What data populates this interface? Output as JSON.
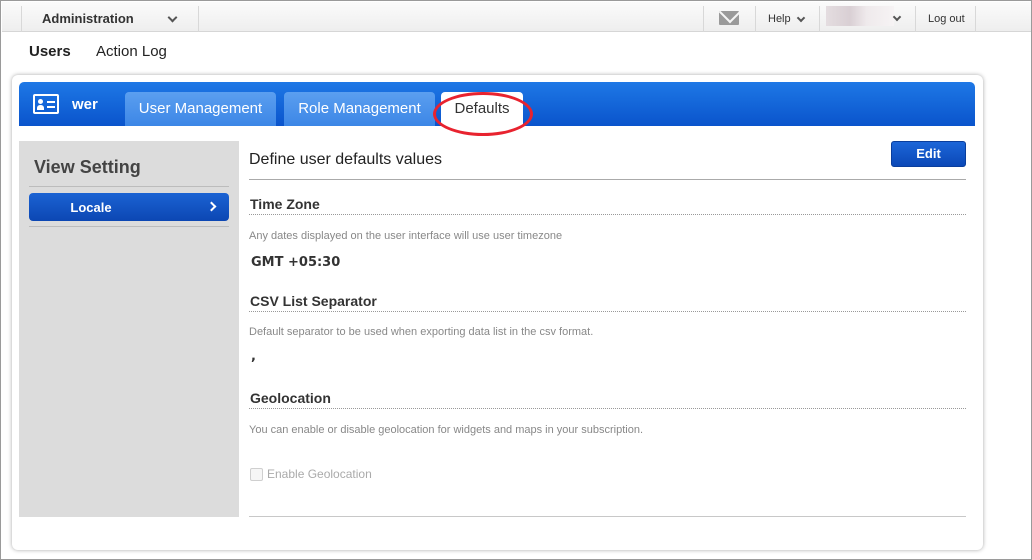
{
  "topbar": {
    "module_label": "Administration",
    "mail_icon": "envelope-icon",
    "help_label": "Help",
    "logout_label": "Log out"
  },
  "subnav": {
    "users_label": "Users",
    "action_log_label": "Action Log"
  },
  "header": {
    "icon": "id-card-icon",
    "title": "wer",
    "tabs": [
      {
        "label": "User Management",
        "active": false
      },
      {
        "label": "Role Management",
        "active": false
      },
      {
        "label": "Defaults",
        "active": true
      }
    ],
    "highlight_color": "#e8232f"
  },
  "sidebar": {
    "title": "View Setting",
    "items": [
      {
        "label": "Locale",
        "active": true
      }
    ]
  },
  "main": {
    "title": "Define user defaults values",
    "edit_label": "Edit",
    "sections": [
      {
        "title": "Time Zone",
        "description": "Any dates displayed on the user interface will use user timezone",
        "value": "GMT +05:30"
      },
      {
        "title": "CSV List Separator",
        "description": "Default separator to be used when exporting data list in the csv format.",
        "value": ","
      },
      {
        "title": "Geolocation",
        "description": "You can enable or disable geolocation for widgets and maps in your subscription.",
        "checkbox_label": "Enable Geolocation",
        "checkbox_checked": false,
        "checkbox_disabled": true
      }
    ]
  },
  "colors": {
    "primary_blue": "#0a54cc",
    "tab_blue": "#3c86e6",
    "sidebar_bg": "#dcdcdc"
  }
}
